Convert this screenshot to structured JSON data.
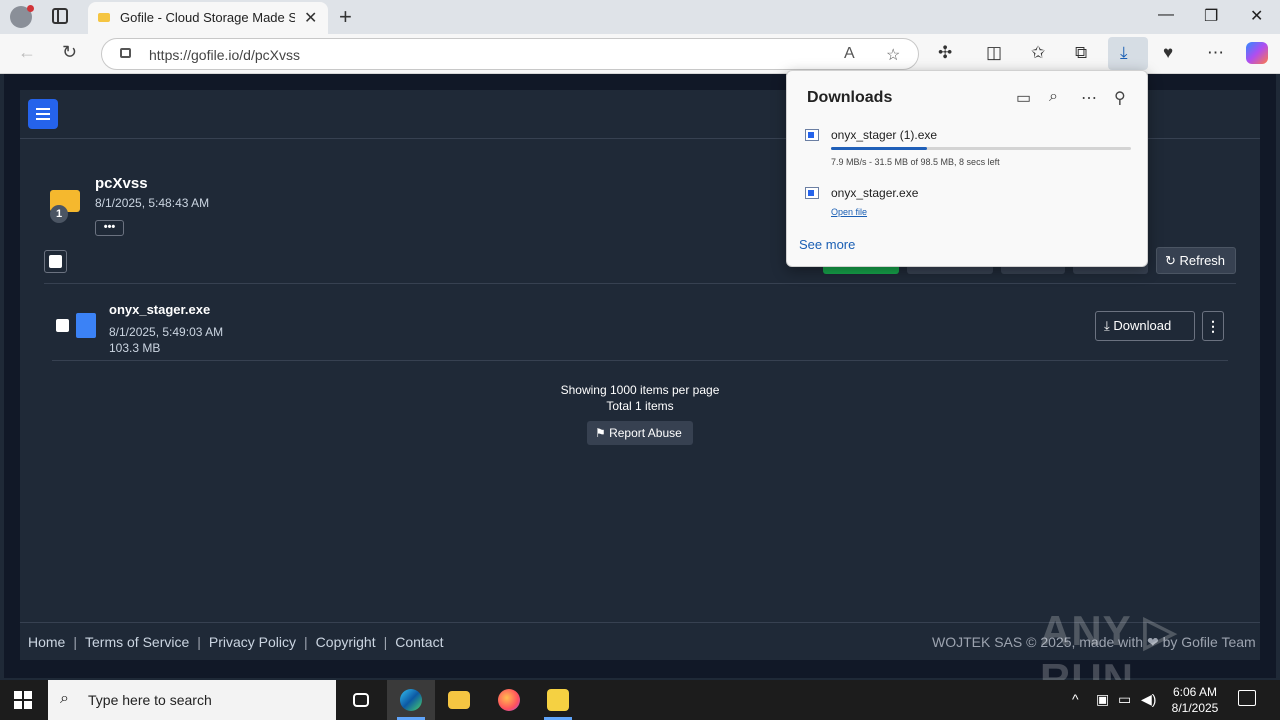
{
  "browser": {
    "tab_title": "Gofile - Cloud Storage Made Simple",
    "url": "https://gofile.io/d/pcXvss"
  },
  "downloads": {
    "title": "Downloads",
    "items": [
      {
        "name": "onyx_stager (1).exe",
        "status": "7.9 MB/s - 31.5 MB of 98.5 MB, 8 secs left",
        "progress": 0.32
      },
      {
        "name": "onyx_stager.exe",
        "action": "Open file"
      }
    ],
    "see_more": "See more"
  },
  "folder": {
    "name": "pcXvss",
    "date": "8/1/2025, 5:48:43 AM",
    "badge": "1",
    "more": "•••"
  },
  "toolbar": {
    "refresh_label": "Refresh"
  },
  "files": [
    {
      "name": "onyx_stager.exe",
      "date": "8/1/2025, 5:49:03 AM",
      "size": "103.3 MB",
      "download_label": "Download"
    }
  ],
  "pagination": {
    "per_page": "Showing 1000 items per page",
    "total": "Total 1 items"
  },
  "report_label": "Report Abuse",
  "footer": {
    "links": [
      "Home",
      "Terms of Service",
      "Privacy Policy",
      "Copyright",
      "Contact"
    ],
    "right": "WOJTEK SAS © 2025, made with ❤ by Gofile Team"
  },
  "watermark": "ANY ▷ RUN",
  "taskbar": {
    "search_placeholder": "Type here to search",
    "time": "6:06 AM",
    "date": "8/1/2025"
  },
  "colors": {
    "accent_blue": "#2563eb",
    "page_bg": "#111827",
    "panel_bg": "#1f2937",
    "progress": "#1f5fb8"
  }
}
